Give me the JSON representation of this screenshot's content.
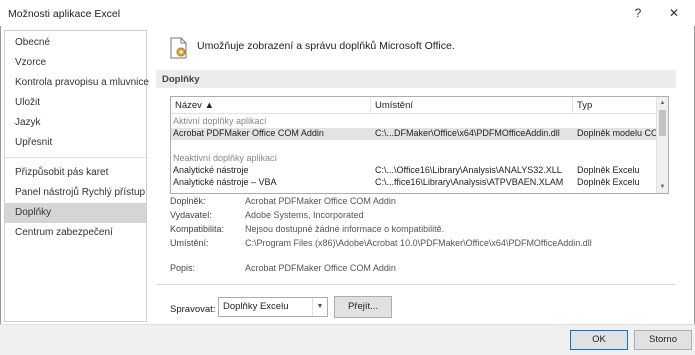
{
  "window": {
    "title": "Možnosti aplikace Excel",
    "help_glyph": "?",
    "close_glyph": "✕"
  },
  "sidebar": {
    "items": [
      {
        "label": "Obecné"
      },
      {
        "label": "Vzorce"
      },
      {
        "label": "Kontrola pravopisu a mluvnice"
      },
      {
        "label": "Uložit"
      },
      {
        "label": "Jazyk"
      },
      {
        "label": "Upřesnit"
      },
      {
        "label": "Přizpůsobit pás karet"
      },
      {
        "label": "Panel nástrojů Rychlý přístup"
      },
      {
        "label": "Doplňky",
        "selected": true
      },
      {
        "label": "Centrum zabezpečení"
      }
    ]
  },
  "main": {
    "header_text": "Umožňuje zobrazení a správu doplňků Microsoft Office.",
    "section_title": "Doplňky",
    "columns": {
      "name": "Název",
      "location": "Umístění",
      "type": "Typ"
    },
    "active_group": "Aktivní doplňky aplikací",
    "active_rows": [
      {
        "name": "Acrobat PDFMaker Office COM Addin",
        "location": "C:\\...DFMaker\\Office\\x64\\PDFMOfficeAddin.dll",
        "type": "Doplněk modelu COM"
      }
    ],
    "inactive_group": "Neaktivní doplňky aplikací",
    "inactive_rows": [
      {
        "name": "Analytické nástroje",
        "location": "C:\\...\\Office16\\Library\\Analysis\\ANALYS32.XLL",
        "type": "Doplněk Excelu"
      },
      {
        "name": "Analytické nástroje – VBA",
        "location": "C:\\...ffice16\\Library\\Analysis\\ATPVBAEN.XLAM",
        "type": "Doplněk Excelu"
      }
    ],
    "details": {
      "addin_label": "Doplněk:",
      "addin_value": "Acrobat PDFMaker Office COM Addin",
      "publisher_label": "Vydavatel:",
      "publisher_value": "Adobe Systems, Incorporated",
      "compat_label": "Kompatibilita:",
      "compat_value": "Nejsou dostupné žádné informace o kompatibilitě.",
      "location_label": "Umístění:",
      "location_value": "C:\\Program Files (x86)\\Adobe\\Acrobat 10.0\\PDFMaker\\Office\\x64\\PDFMOfficeAddin.dll",
      "desc_label": "Popis:",
      "desc_value": "Acrobat PDFMaker Office COM Addin"
    },
    "manage": {
      "label": "Spravovat:",
      "selected": "Doplňky Excelu",
      "go_label": "Přejít..."
    }
  },
  "footer": {
    "ok_label": "OK",
    "cancel_label": "Storno"
  },
  "colors": {
    "selected_nav": "#d5d5d5",
    "ok_border": "#0078d7"
  }
}
